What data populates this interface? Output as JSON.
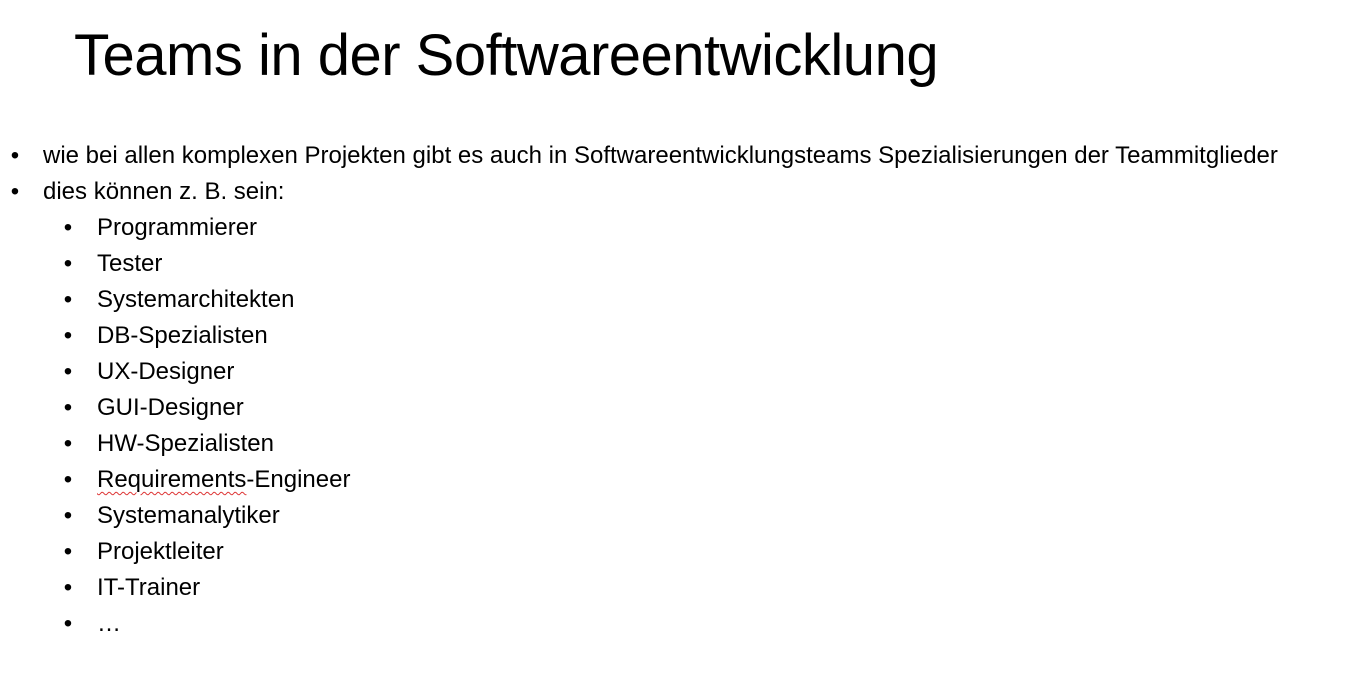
{
  "slide": {
    "title": "Teams in der Softwareentwicklung",
    "bullets": [
      {
        "text": "wie bei allen komplexen Projekten gibt es auch in Softwareentwicklungsteams Spezialisierungen der Teammitglieder"
      },
      {
        "text": "dies können z. B. sein:"
      }
    ],
    "roles": [
      "Programmierer",
      "Tester",
      "Systemarchitekten",
      "DB-Spezialisten",
      "UX-Designer",
      "GUI-Designer",
      "HW-Spezialisten",
      "Requirements-Engineer",
      "Systemanalytiker",
      "Projektleiter",
      "IT-Trainer",
      "…"
    ],
    "roles_split": {
      "requirements_prefix": "Requirements",
      "requirements_suffix": "-Engineer"
    },
    "bullet_glyph": "•"
  }
}
